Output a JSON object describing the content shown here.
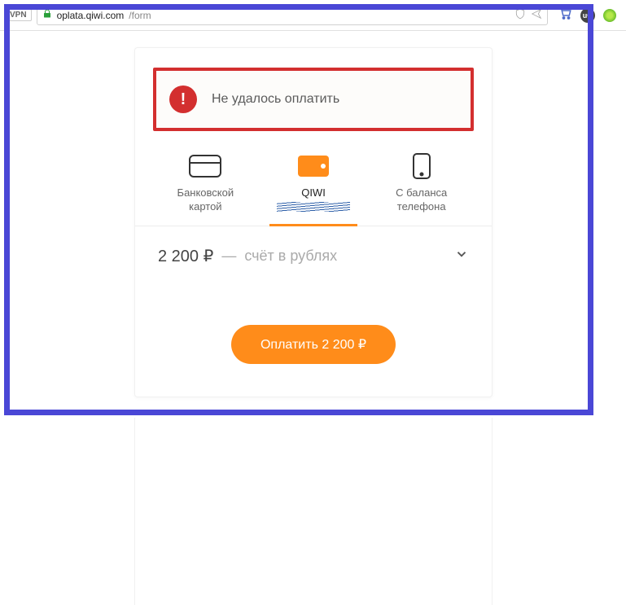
{
  "browser": {
    "vpn_label": "VPN",
    "url_domain": "oplata.qiwi.com",
    "url_path": "/form"
  },
  "error": {
    "message": "Не удалось оплатить"
  },
  "tabs": {
    "card": {
      "line1": "Банковской",
      "line2": "картой"
    },
    "qiwi": {
      "label": "QIWI"
    },
    "phone": {
      "line1": "С баланса",
      "line2": "телефона"
    }
  },
  "account": {
    "amount": "2 200 ₽",
    "separator": "—",
    "description": "счёт в рублях"
  },
  "pay_button": {
    "label": "Оплатить 2 200 ₽"
  }
}
